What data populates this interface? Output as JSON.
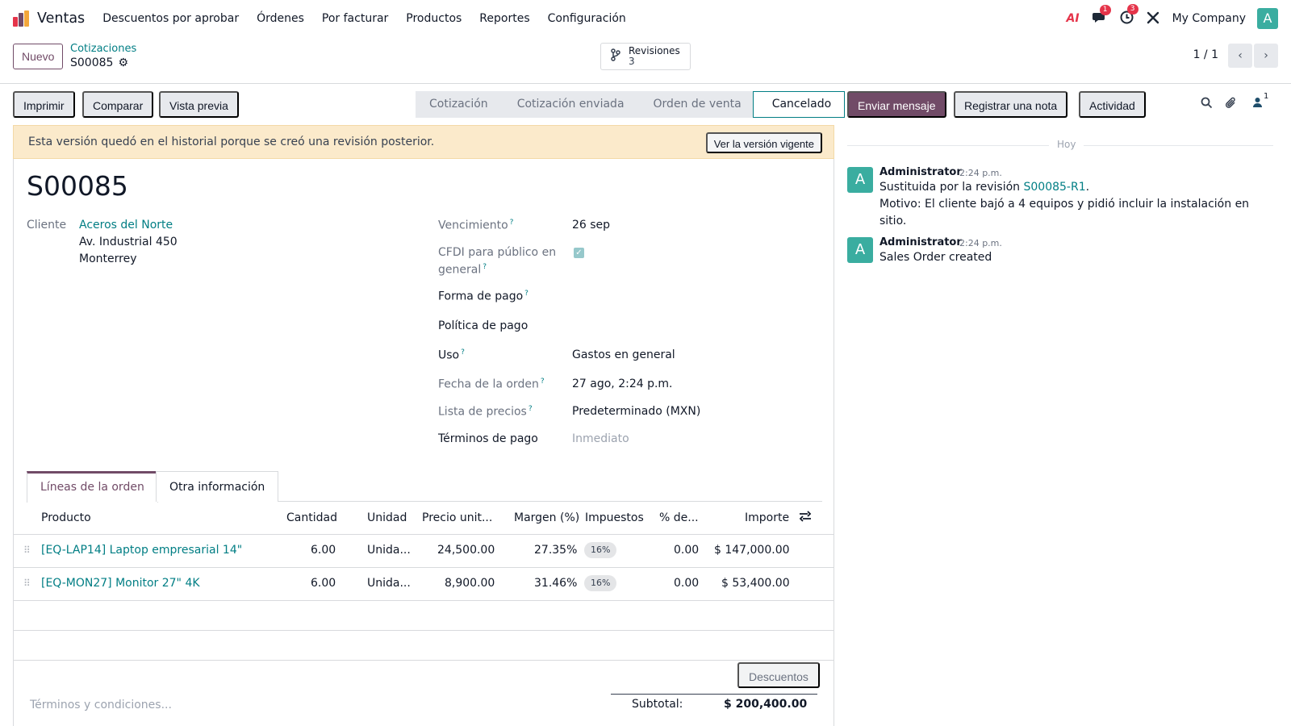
{
  "nav": {
    "app_title": "Ventas",
    "menu": [
      "Descuentos por aprobar",
      "Órdenes",
      "Por facturar",
      "Productos",
      "Reportes",
      "Configuración"
    ],
    "ai_label": "AI",
    "messages_badge": "1",
    "activities_badge": "3",
    "company": "My Company",
    "user_initial": "A",
    "logo_colors": [
      "#e5344a",
      "#714b67",
      "#f3a73b"
    ]
  },
  "control_panel": {
    "new_label": "Nuevo",
    "breadcrumb_parent": "Cotizaciones",
    "breadcrumb_current": "S00085",
    "revisions_label": "Revisiones",
    "revisions_count": "3",
    "pager": "1 / 1"
  },
  "actions": {
    "print": "Imprimir",
    "compare": "Comparar",
    "preview": "Vista previa"
  },
  "status": {
    "stages": [
      "Cotización",
      "Cotización enviada",
      "Orden de venta",
      "Cancelado"
    ],
    "active": "Cancelado"
  },
  "alert": {
    "text": "Esta versión quedó en el historial porque se creó una revisión posterior.",
    "button": "Ver la versión vigente"
  },
  "form": {
    "name": "S00085",
    "customer_label": "Cliente",
    "customer_name": "Aceros del Norte",
    "customer_street": "Av. Industrial 450",
    "customer_city": "Monterrey",
    "expiration_label": "Vencimiento",
    "expiration_value": "26 sep",
    "cfdi_label_1": "CFDI para público en",
    "cfdi_label_2": "general",
    "cfdi_checked": true,
    "payment_method_label": "Forma de pago",
    "payment_policy_label": "Política de pago",
    "usage_label": "Uso",
    "usage_value": "Gastos en general",
    "order_date_label": "Fecha de la orden",
    "order_date_value": "27 ago, 2:24 p.m.",
    "pricelist_label": "Lista de precios",
    "pricelist_value": "Predeterminado (MXN)",
    "terms_label": "Términos de pago",
    "terms_placeholder": "Inmediato",
    "help_mark": "?"
  },
  "tabs": [
    "Líneas de la orden",
    "Otra información"
  ],
  "table": {
    "headers": {
      "product": "Producto",
      "qty": "Cantidad",
      "unit": "Unidad",
      "price": "Precio unit...",
      "margin": "Margen (%)",
      "taxes": "Impuestos",
      "discount": "% de...",
      "amount": "Importe"
    },
    "rows": [
      {
        "product": "[EQ-LAP14] Laptop empresarial 14\"",
        "qty": "6.00",
        "unit": "Unida...",
        "price": "24,500.00",
        "margin": "27.35%",
        "tax": "16%",
        "discount": "0.00",
        "amount": "$ 147,000.00"
      },
      {
        "product": "[EQ-MON27] Monitor 27\" 4K",
        "qty": "6.00",
        "unit": "Unida...",
        "price": "8,900.00",
        "margin": "31.46%",
        "tax": "16%",
        "discount": "0.00",
        "amount": "$ 53,400.00"
      }
    ],
    "discounts_button": "Descuentos",
    "terms_placeholder": "Términos y condiciones...",
    "subtotal_label": "Subtotal:",
    "subtotal_value": "$ 200,400.00"
  },
  "chatter": {
    "send_message": "Enviar mensaje",
    "log_note": "Registrar una nota",
    "activity": "Actividad",
    "followers_count": "1",
    "today": "Hoy",
    "messages": [
      {
        "author": "Administrator",
        "time": "2:24 p.m.",
        "avatar": "A",
        "line1_prefix": "Sustituida por la revisión ",
        "line1_link": "S00085-R1",
        "line1_suffix": ".",
        "line2": "Motivo: El cliente bajó a 4 equipos y pidió incluir la instalación en",
        "line3": "sitio."
      },
      {
        "author": "Administrator",
        "time": "2:24 p.m.",
        "avatar": "A",
        "body": "Sales Order created"
      }
    ]
  }
}
